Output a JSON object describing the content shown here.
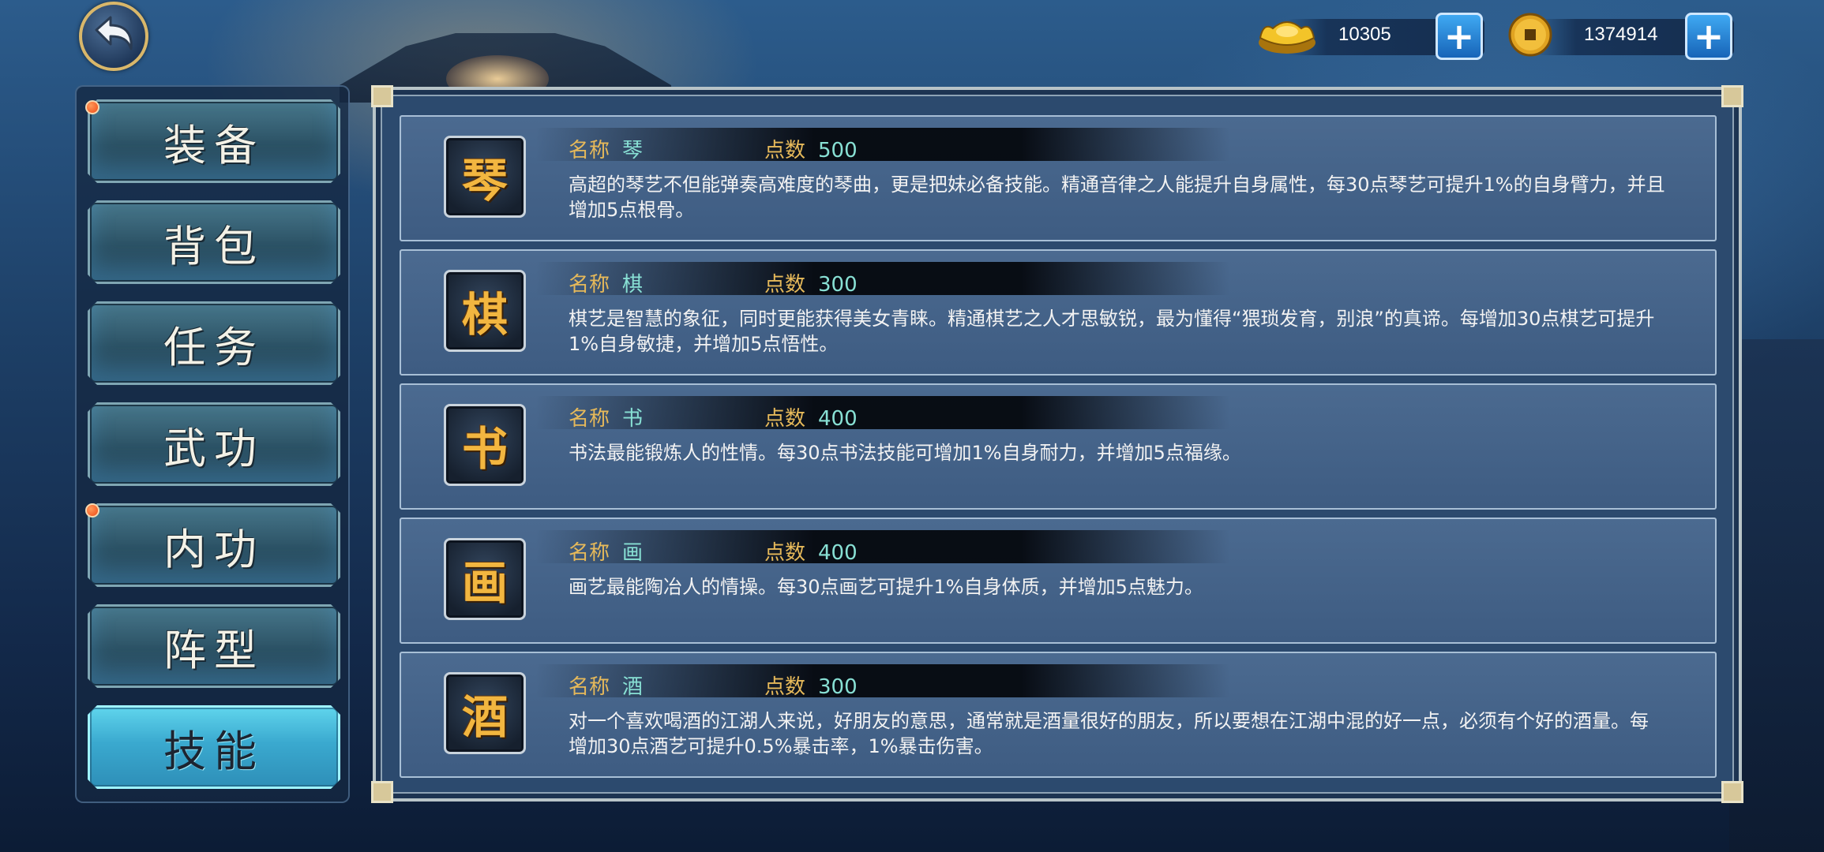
{
  "currency": {
    "gold": {
      "icon": "gold-ingot-icon",
      "value": "10305"
    },
    "coin": {
      "icon": "copper-coin-icon",
      "value": "1374914"
    }
  },
  "menu": {
    "items": [
      {
        "label": "装备",
        "badge": true
      },
      {
        "label": "背包",
        "badge": false
      },
      {
        "label": "任务",
        "badge": false
      },
      {
        "label": "武功",
        "badge": false
      },
      {
        "label": "内功",
        "badge": true
      },
      {
        "label": "阵型",
        "badge": false
      },
      {
        "label": "技能",
        "badge": false,
        "active": true
      }
    ]
  },
  "skills": {
    "name_label": "名称",
    "points_label": "点数",
    "items": [
      {
        "glyph": "琴",
        "name": "琴",
        "points": "500",
        "desc": "高超的琴艺不但能弹奏高难度的琴曲，更是把妹必备技能。精通音律之人能提升自身属性，每30点琴艺可提升1%的自身臂力，并且增加5点根骨。"
      },
      {
        "glyph": "棋",
        "name": "棋",
        "points": "300",
        "desc": "棋艺是智慧的象征，同时更能获得美女青睐。精通棋艺之人才思敏锐，最为懂得“猥琐发育，别浪”的真谛。每增加30点棋艺可提升1%自身敏捷，并增加5点悟性。"
      },
      {
        "glyph": "书",
        "name": "书",
        "points": "400",
        "desc": "书法最能锻炼人的性情。每30点书法技能可增加1%自身耐力，并增加5点福缘。"
      },
      {
        "glyph": "画",
        "name": "画",
        "points": "400",
        "desc": "画艺最能陶冶人的情操。每30点画艺可提升1%自身体质，并增加5点魅力。"
      },
      {
        "glyph": "酒",
        "name": "酒",
        "points": "300",
        "desc": "对一个喜欢喝酒的江湖人来说，好朋友的意思，通常就是酒量很好的朋友，所以要想在江湖中混的好一点，必须有个好的酒量。每增加30点酒艺可提升0.5%暴击率，1%暴击伤害。"
      }
    ]
  },
  "colors": {
    "accent_gold": "#e6b95a",
    "value_teal": "#88e0d4",
    "active_tab": "#5fd4ec",
    "badge_red": "#f04a16"
  }
}
